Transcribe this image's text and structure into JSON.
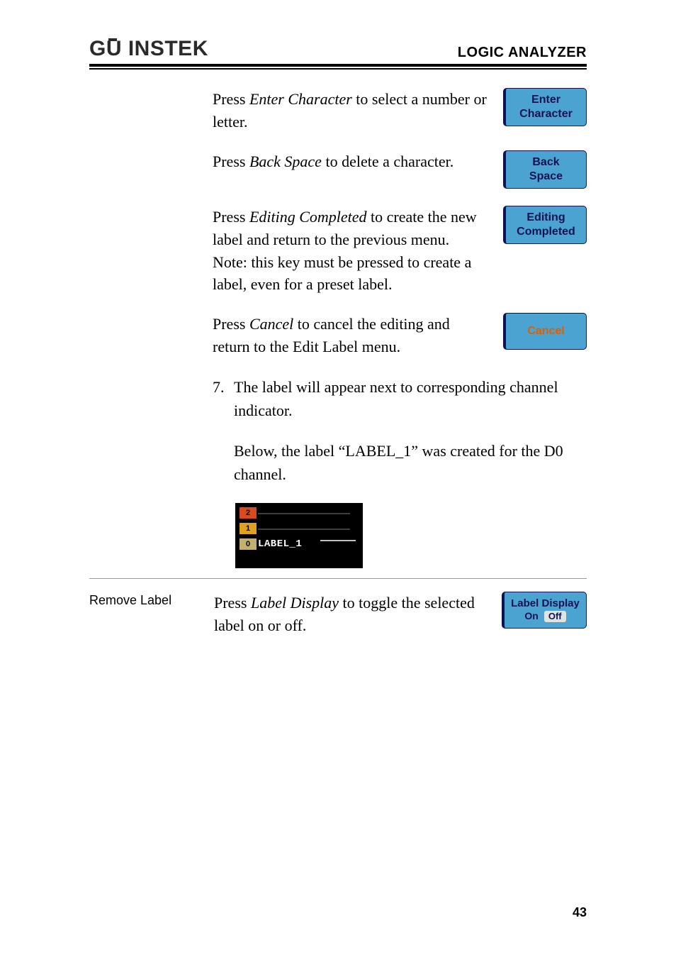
{
  "header": {
    "logo_text": "GWINSTEK",
    "section": "LOGIC ANALYZER"
  },
  "blocks": {
    "enter_char": {
      "pre": "Press ",
      "em": "Enter Character",
      "post": " to select a number or letter.",
      "key_l1": "Enter",
      "key_l2": "Character"
    },
    "back_space": {
      "pre": "Press ",
      "em": "Back Space",
      "post": " to delete a character.",
      "key_l1": "Back",
      "key_l2": "Space"
    },
    "editing_completed": {
      "pre": "Press ",
      "em": "Editing Completed",
      "post": " to create the new label and return to the previous menu.",
      "note": "Note: this key must be pressed to create a label, even for a preset label.",
      "key_l1": "Editing",
      "key_l2": "Completed"
    },
    "cancel": {
      "pre": "Press ",
      "em": "Cancel",
      "post": " to cancel the editing and return to the Edit Label menu.",
      "key_l1": "Cancel"
    }
  },
  "step7": {
    "num": "7.",
    "p1": "The label will appear next to corresponding channel indicator.",
    "p2": "Below, the label “LABEL_1” was created for the D0 channel."
  },
  "screenshot": {
    "ch2": "2",
    "ch1": "1",
    "ch0": "0",
    "label": "LABEL_1"
  },
  "remove": {
    "heading": "Remove Label",
    "pre": "Press ",
    "em": "Label Display",
    "post": " to toggle the selected label on or off.",
    "key_title": "Label Display",
    "opt_on": "On",
    "opt_off": "Off"
  },
  "page_number": "43"
}
